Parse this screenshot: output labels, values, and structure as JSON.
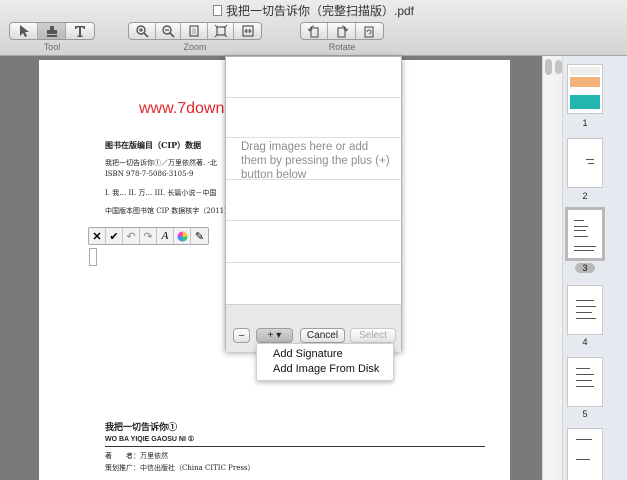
{
  "window": {
    "title": "我把一切告诉你（完整扫描版）.pdf"
  },
  "toolbar": {
    "groups": [
      {
        "label": "Tool"
      },
      {
        "label": "Zoom"
      },
      {
        "label": "Rotate"
      }
    ]
  },
  "document": {
    "watermark": "www.7down.",
    "lines": [
      "图书在版编目（CIP）数据",
      "我把一切告诉你①／万里依然著. -北",
      "ISBN 978-7-5086-3105-9",
      "I. 我…  II. 万…  III. 长篇小说－中国",
      "中国版本图书馆 CIP 数据核字（2011）"
    ],
    "book_title": "我把一切告诉你①",
    "book_title_pinyin": "WO BA YIQIE GAOSU NI ①",
    "author_line": "著　　者：万里依然",
    "publisher_line": "策划推广：中信出版社（China CITIC Press）"
  },
  "signature_dialog": {
    "hint": "Drag images here or add them by pressing the plus (+) button below",
    "minus_label": "–",
    "plus_label": "+ ▾",
    "cancel_label": "Cancel",
    "select_label": "Select"
  },
  "add_menu": {
    "items": [
      {
        "label": "Add Signature"
      },
      {
        "label": "Add Image From Disk"
      }
    ]
  },
  "thumbnails": [
    {
      "number": "1"
    },
    {
      "number": "2"
    },
    {
      "number": "3"
    },
    {
      "number": "4"
    },
    {
      "number": "5"
    }
  ],
  "selected_page": "3",
  "colors": {
    "watermark": "#e0262a",
    "background": "#7a7a7a"
  }
}
